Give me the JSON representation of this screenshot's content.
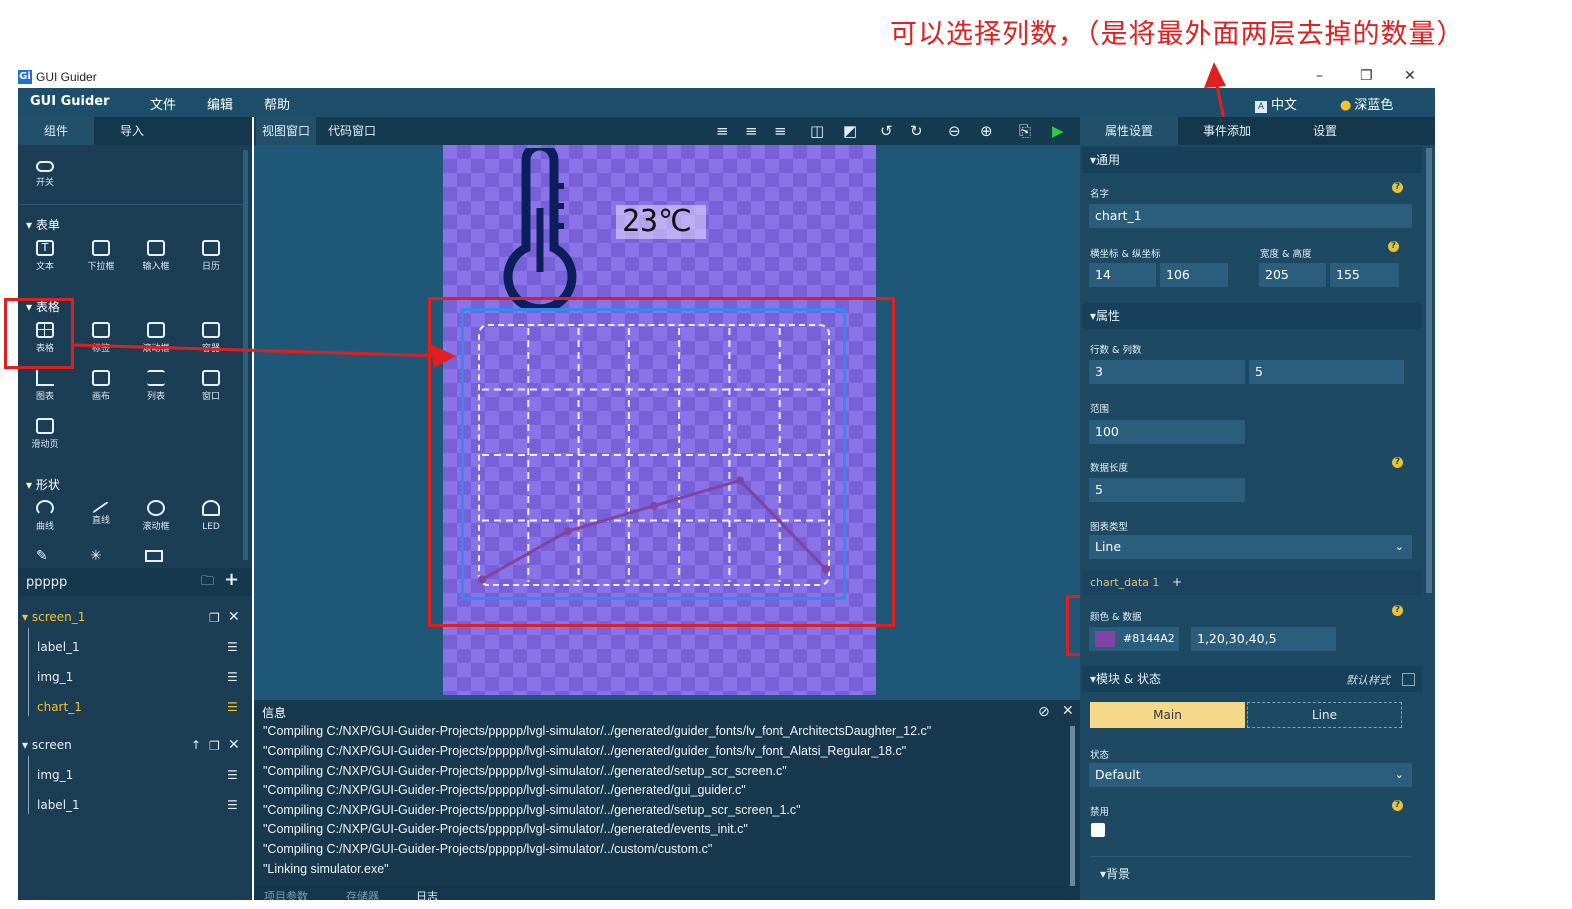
{
  "annotation": {
    "text": "可以选择列数，（是将最外面两层去掉的数量）"
  },
  "window": {
    "title": "GUI Guider",
    "app_icon": "Gi"
  },
  "menubar": {
    "brand": "GUI Guider",
    "items": [
      "文件",
      "编辑",
      "帮助"
    ],
    "language": "中文",
    "theme": "深蓝色"
  },
  "left_tabs": [
    "组件",
    "导入"
  ],
  "palette": {
    "top_item": "开关",
    "sections": [
      {
        "title": "表单",
        "items": [
          "文本",
          "下拉框",
          "输入框",
          "日历"
        ]
      },
      {
        "title": "表格",
        "items": [
          "表格",
          "标签",
          "滚动框",
          "容器",
          "图表",
          "画布",
          "列表",
          "窗口",
          "滑动页"
        ]
      },
      {
        "title": "形状",
        "items": [
          "曲线",
          "直线",
          "滚动框",
          "LED"
        ]
      }
    ]
  },
  "project": {
    "name": "ppppp",
    "screens": [
      {
        "name": "screen_1",
        "children": [
          "label_1",
          "img_1",
          "chart_1"
        ]
      },
      {
        "name": "screen",
        "children": [
          "img_1",
          "label_1"
        ]
      }
    ]
  },
  "view_tabs": [
    "视图窗口",
    "代码窗口"
  ],
  "toolbar_icons": [
    "align-left-icon",
    "align-center-icon",
    "align-right-icon",
    "bring-forward-icon",
    "send-backward-icon",
    "undo-icon",
    "redo-icon",
    "zoom-out-icon",
    "zoom-in-icon",
    "export-icon",
    "run-icon"
  ],
  "canvas": {
    "temperature": "23℃",
    "chart_color": "#8144A2",
    "chart_values": [
      1,
      20,
      30,
      40,
      5
    ],
    "chart_range": 100,
    "rows": 3,
    "cols": 5
  },
  "info": {
    "title": "信息",
    "lines": [
      "\"Compiling C:/NXP/GUI-Guider-Projects/ppppp/lvgl-simulator/../generated/guider_fonts/lv_font_ArchitectsDaughter_12.c\"",
      "\"Compiling C:/NXP/GUI-Guider-Projects/ppppp/lvgl-simulator/../generated/guider_fonts/lv_font_Alatsi_Regular_18.c\"",
      "\"Compiling C:/NXP/GUI-Guider-Projects/ppppp/lvgl-simulator/../generated/setup_scr_screen.c\"",
      "\"Compiling C:/NXP/GUI-Guider-Projects/ppppp/lvgl-simulator/../generated/gui_guider.c\"",
      "\"Compiling C:/NXP/GUI-Guider-Projects/ppppp/lvgl-simulator/../generated/setup_scr_screen_1.c\"",
      "\"Compiling C:/NXP/GUI-Guider-Projects/ppppp/lvgl-simulator/../generated/events_init.c\"",
      "\"Compiling C:/NXP/GUI-Guider-Projects/ppppp/lvgl-simulator/../custom/custom.c\"",
      "\"Linking simulator.exe\""
    ],
    "bottom_tabs": [
      "项目参数",
      "存储器",
      "日志"
    ]
  },
  "right_tabs": [
    "属性设置",
    "事件添加",
    "设置"
  ],
  "props": {
    "general_title": "▾通用",
    "name_label": "名字",
    "name_value": "chart_1",
    "xy_label": "横坐标 & 纵坐标",
    "x": "14",
    "y": "106",
    "wh_label": "宽度 & 高度",
    "w": "205",
    "h": "155",
    "attr_title": "▾属性",
    "rc_label": "行数 & 列数",
    "rows": "3",
    "cols": "5",
    "range_label": "范围",
    "range": "100",
    "datalen_label": "数据长度",
    "datalen": "5",
    "type_label": "图表类型",
    "type": "Line",
    "series_tab": "chart_data 1",
    "series_add": "+",
    "color_label": "颜色 & 数据",
    "color": "#8144A2",
    "data": "1,20,30,40,5",
    "part_title": "▾模块 & 状态",
    "default_style": "默认样式",
    "part_main": "Main",
    "part_line": "Line",
    "state_label": "状态",
    "state": "Default",
    "disable_label": "禁用",
    "bg_title": "▾背景"
  }
}
